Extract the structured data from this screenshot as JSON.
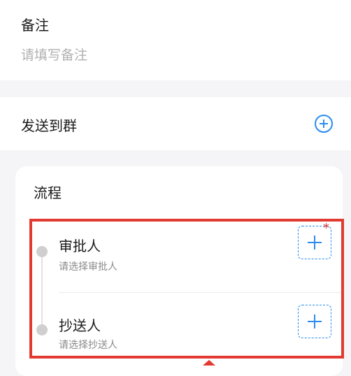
{
  "remark": {
    "label": "备注",
    "placeholder": "请填写备注"
  },
  "send_to_group": {
    "label": "发送到群",
    "add_icon": "plus-circle-icon"
  },
  "flow": {
    "title": "流程",
    "steps": [
      {
        "label": "审批人",
        "hint": "请选择审批人",
        "required": true,
        "required_mark": "*"
      },
      {
        "label": "抄送人",
        "hint": "请选择抄送人",
        "required": false
      }
    ]
  },
  "colors": {
    "accent": "#2b8cf0",
    "highlight": "#e23a30",
    "required": "#e8392f"
  }
}
